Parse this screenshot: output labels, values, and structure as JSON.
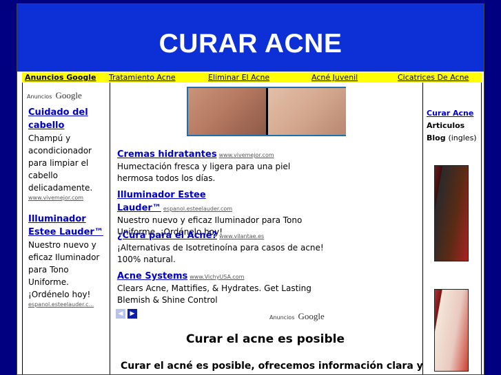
{
  "header": {
    "title": "CURAR ACNE"
  },
  "nav": {
    "ads_label": "Anuncios Google",
    "items": [
      "Tratamiento Acne",
      "Eliminar El Acne",
      "Acné Juvenil",
      "Cicatrices De Acne"
    ]
  },
  "left_ads": {
    "label_small": "Anuncios",
    "label_brand": "Google",
    "items": [
      {
        "title": "Cuidado del cabello",
        "desc": "Champú y acondicionador para limpiar el cabello delicadamente.",
        "url": "www.vivemejor.com"
      },
      {
        "title": "Illuminador Estee Lauder™",
        "desc": "Nuestro nuevo y eficaz Iluminador para Tono Uniforme. ¡Ordénelo hoy!",
        "url": "espanol.esteelauder.c..."
      }
    ]
  },
  "center_ads": {
    "items": [
      {
        "title": "Cremas hidratantes",
        "url": "www.vivemejor.com",
        "desc": "Humectación fresca y ligera para una piel hermosa todos los días."
      },
      {
        "title": "Illuminador Estee Lauder™",
        "url": "espanol.esteelauder.com",
        "desc": "Nuestro nuevo y eficaz Iluminador para Tono Uniforme. ¡Ordénelo hoy!"
      },
      {
        "title": "¿Cura para el Acné?",
        "url": "www.vilantae.es",
        "desc": "¡Alternativas de Isotretinoína para casos de acne! 100% natural."
      },
      {
        "title": "Acne Systems",
        "url": "www.VichyUSA.com",
        "desc": "Clears Acne, Mattifies, & Hydrates. Get Lasting Blemish & Shine Control"
      }
    ],
    "label_small": "Anuncios",
    "label_brand": "Google"
  },
  "content": {
    "title": "Curar el acne es posible",
    "intro": "Curar el acné es posible, ofrecemos información clara y"
  },
  "right": {
    "link": "Curar Acne",
    "articulos": "Articulos",
    "blog": "Blog",
    "blog_note": "(ingles)"
  },
  "colors": {
    "page_bg": "#000080",
    "header_bg": "#0d2fd6",
    "nav_bg": "#ffff00",
    "link": "#0000cc"
  }
}
